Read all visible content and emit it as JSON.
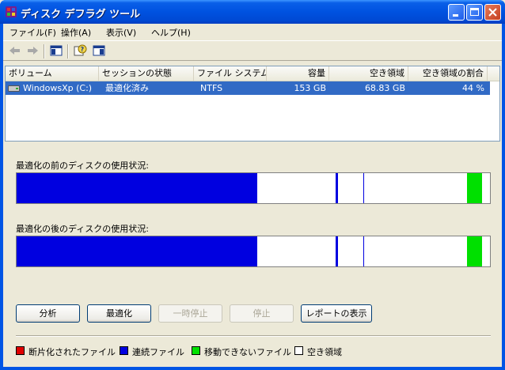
{
  "window": {
    "title": "ディスク デフラグ ツール"
  },
  "menu": [
    "ファイル(F)",
    "操作(A)",
    "表示(V)",
    "ヘルプ(H)"
  ],
  "columns": [
    "ボリューム",
    "セッションの状態",
    "ファイル システム",
    "容量",
    "空き領域",
    "空き領域の割合"
  ],
  "row": {
    "volume": "WindowsXp (C:)",
    "status": "最適化済み",
    "filesystem": "NTFS",
    "capacity": "153 GB",
    "free": "68.83 GB",
    "free_percent": "44 %"
  },
  "before_label": "最適化の前のディスクの使用状況:",
  "after_label": "最適化の後のディスクの使用状況:",
  "buttons": {
    "analyze": "分析",
    "defragment": "最適化",
    "pause": "一時停止",
    "stop": "停止",
    "report": "レポートの表示"
  },
  "legend": [
    {
      "label": "断片化されたファイル",
      "color": "#e00000"
    },
    {
      "label": "連続ファイル",
      "color": "#0000e0"
    },
    {
      "label": "移動できないファイル",
      "color": "#00e000"
    },
    {
      "label": "空き領域",
      "color": "#ffffff"
    }
  ],
  "colors": {
    "contiguous": "#0000e0",
    "unmovable": "#00e000",
    "fragmented": "#e00000",
    "free": "#ffffff",
    "selection": "#316ac5"
  }
}
